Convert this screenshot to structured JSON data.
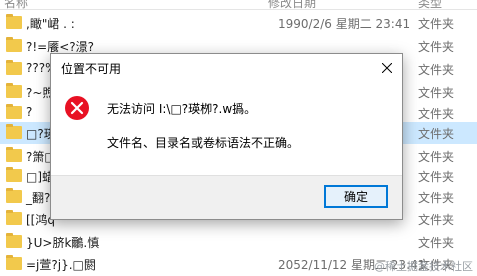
{
  "header": {
    "name": "名称",
    "date": "修改日期",
    "type": "类型"
  },
  "rows": [
    {
      "name": ",瞰\"峮  .  :",
      "date": "1990/2/6 星期二 23:41",
      "type": "文件夹"
    },
    {
      "name": "?!=餍<?澋?",
      "date": "",
      "type": "文件夹"
    },
    {
      "name": "???%",
      "date": "",
      "type": "文件夹"
    },
    {
      "name": "?~煦",
      "date": "",
      "type": "文件夹"
    },
    {
      "name": "?",
      "date": "",
      "type": "文件夹"
    },
    {
      "name": "□?瑛",
      "date": "",
      "type": "文件夹"
    },
    {
      "name": "?箫□",
      "date": "",
      "type": "文件夹"
    },
    {
      "name": "□]蜡",
      "date": "",
      "type": "文件夹"
    },
    {
      "name": "_翻?",
      "date": "",
      "type": "文件夹"
    },
    {
      "name": "[[鸿q",
      "date": "",
      "type": "文件夹"
    },
    {
      "name": "}U>脐k鸍.慎",
      "date": "",
      "type": "文件夹"
    },
    {
      "name": "=j萱?j}.□閼",
      "date": "2052/11/12 星期二 23:41",
      "type": "文件夹"
    }
  ],
  "dialog": {
    "title": "位置不可用",
    "message1": "无法访问 I:\\□?瑛栁?.w撝。",
    "message2": "文件名、目录名或卷标语法不正确。",
    "ok_label": "确定"
  },
  "watermark": "@稀土掘金技术社区",
  "colors": {
    "accent": "#0078d7",
    "error": "#e81123",
    "selection": "#cce8ff",
    "folder": "#f2c94c"
  },
  "icons": {
    "folder": "folder-icon",
    "error": "error-icon",
    "close": "close-icon"
  }
}
